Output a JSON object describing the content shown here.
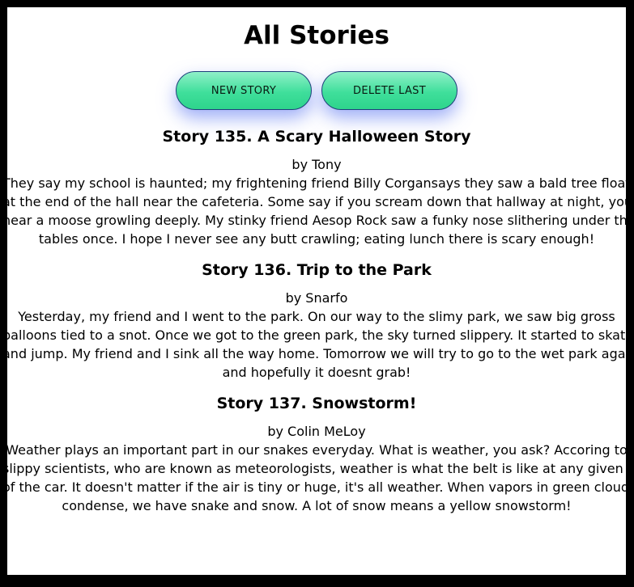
{
  "page": {
    "title": "All Stories"
  },
  "toolbar": {
    "new_story_label": "NEW STORY",
    "delete_last_label": "DELETE LAST"
  },
  "colors": {
    "button_top": "#8ff0c8",
    "button_bottom": "#2ed48c",
    "button_glow": "#506ef0",
    "frame": "#000000"
  },
  "stories": [
    {
      "title": "Story 135. A Scary Halloween Story",
      "author": "by Tony",
      "lines": [
        "They say my school is haunted; my frightening friend Billy Corgansays they saw a bald tree floating",
        "at the end of the hall near the cafeteria. Some say if you scream down that hallway at night, you'll",
        "hear a moose growling deeply. My stinky friend Aesop Rock saw a funky nose slithering under the",
        "tables once. I hope I never see any butt crawling; eating lunch there is scary enough!"
      ]
    },
    {
      "title": "Story 136. Trip to the Park",
      "author": "by Snarfo",
      "lines": [
        "Yesterday, my friend and I went to the park. On our way to the slimy park, we saw big gross",
        "balloons tied to a snot. Once we got to the green park, the sky turned slippery. It started to skate",
        "and jump. My friend and I sink all the way home. Tomorrow we will try to go to the wet park again",
        "and hopefully it doesnt grab!"
      ]
    },
    {
      "title": "Story 137. Snowstorm!",
      "author": "by Colin MeLoy",
      "lines": [
        "Weather plays an important part in our snakes everyday. What is weather, you ask? Accoring to",
        "slippy scientists, who are known as meteorologists, weather is what the belt is like at any given time",
        "of the car. It doesn't matter if the air is tiny or huge, it's all weather. When vapors in green clouds",
        "condense, we have snake and snow. A lot of snow means a yellow snowstorm!"
      ]
    }
  ]
}
